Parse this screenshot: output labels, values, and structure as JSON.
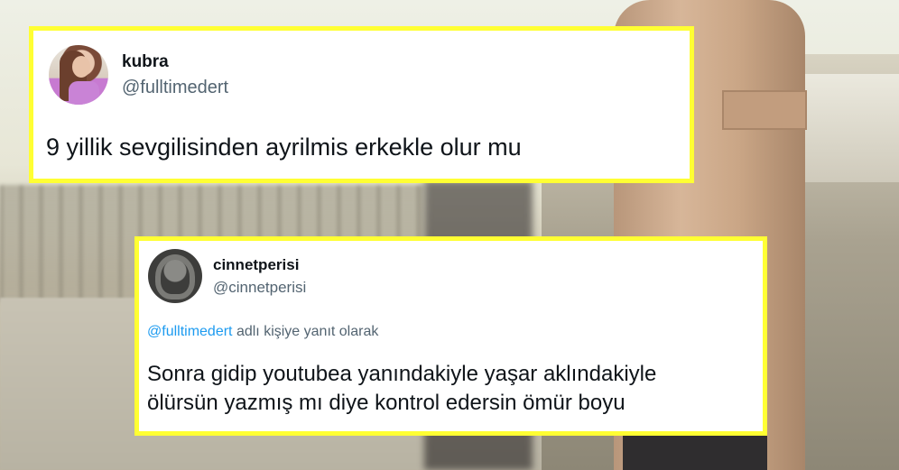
{
  "tweets": [
    {
      "name": "kubra",
      "handle": "@fulltimedert",
      "text": "9 yillik sevgilisinden ayrilmis erkekle olur mu",
      "avatar_icon": "profile-photo-woman-pink-top"
    },
    {
      "name": "cinnetperisi",
      "handle": "@cinnetperisi",
      "reply_mention": "@fulltimedert",
      "reply_suffix": " adlı kişiye yanıt olarak",
      "text_lines": [
        "Sonra gidip youtubea yanındakiyle yaşar aklındakiyle",
        "ölürsün yazmış mı diye kontrol edersin ömür boyu"
      ],
      "avatar_icon": "profile-photo-hooded-figure"
    }
  ],
  "colors": {
    "frame": "#ffff33",
    "link": "#1d9bf0",
    "text": "#0f1419",
    "muted": "#536471"
  }
}
